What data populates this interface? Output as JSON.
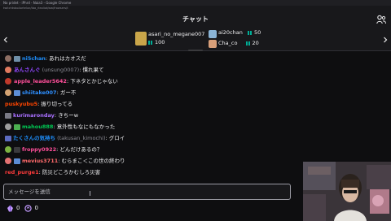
{
  "browser": {
    "window_title": "No pridet - iPhrd - Naia3 - Google Chrome",
    "url": "twitchtvbo4ortelun/tba_rleoliot/ww/frowsers/t"
  },
  "header": {
    "title": "チャット"
  },
  "leaderboard": {
    "entries": [
      {
        "name": "asari_no_megane007",
        "gifts": "100"
      },
      {
        "name": "ai20chan",
        "gifts": "50"
      },
      {
        "name": "Cha_co",
        "gifts": "20"
      }
    ]
  },
  "chat": {
    "messages": [
      {
        "name": "ni5chan",
        "alt": "",
        "sep": ":",
        "text": "あれはカオスだ",
        "color": "#1e90ff"
      },
      {
        "name": "あんさんぐ",
        "alt": "(unsung0007)",
        "sep": ":",
        "text": "慣れ果て",
        "color": "#9147ff"
      },
      {
        "name": "apple_leader5642",
        "alt": "",
        "sep": ":",
        "text": "下ネタとかじゃない",
        "color": "#ff4f9a"
      },
      {
        "name": "shiitake007",
        "alt": "",
        "sep": ":",
        "text": "ガー不",
        "color": "#2e8fff"
      },
      {
        "name": "puskyubu5",
        "alt": "",
        "sep": ":",
        "text": "振り切ってる",
        "color": "#ff4500"
      },
      {
        "name": "kurimaronday",
        "alt": "",
        "sep": ":",
        "text": "きちーw",
        "color": "#a970ff"
      },
      {
        "name": "mahou888",
        "alt": "",
        "sep": ":",
        "text": "意外性もなにもなかった",
        "color": "#00c853"
      },
      {
        "name": "たくさんの気持ち",
        "alt": "(takusan_kimochi)",
        "sep": ":",
        "text": "グロイ",
        "color": "#1e90ff"
      },
      {
        "name": "froppy0922",
        "alt": "",
        "sep": ":",
        "text": "どんだけあるの？",
        "color": "#ff4f9a"
      },
      {
        "name": "mevius3711",
        "alt": "",
        "sep": ":",
        "text": "むらまこ＜この世の終わり",
        "color": "#ff6b6b"
      },
      {
        "name": "red_purge1",
        "alt": "",
        "sep": ":",
        "text": "防災どころかむしろ災害",
        "color": "#ff3b3b"
      }
    ]
  },
  "input": {
    "placeholder": "メッセージを送信"
  },
  "points": {
    "bits": "0",
    "channel_points": "0"
  },
  "colors": {
    "background": "#0e0e10",
    "panel": "#18181b",
    "accent": "#9147ff",
    "gift": "#00ad96"
  }
}
